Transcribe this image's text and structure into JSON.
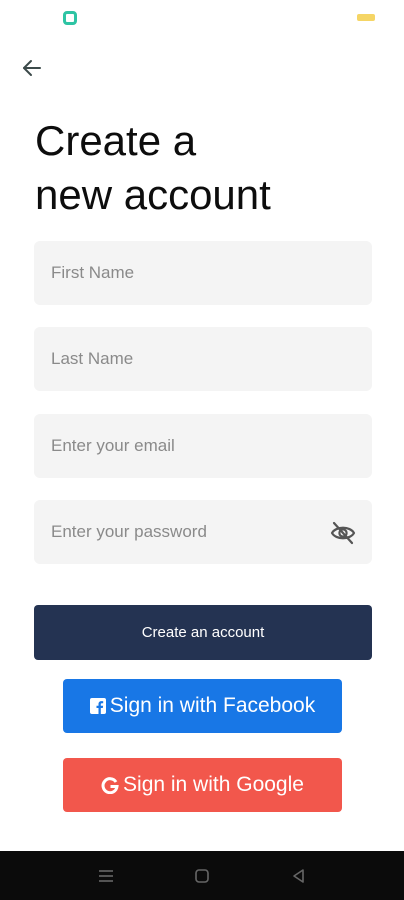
{
  "screen": {
    "title_line1": "Create a",
    "title_line2": "new account"
  },
  "form": {
    "first_name": {
      "placeholder": "First Name",
      "value": ""
    },
    "last_name": {
      "placeholder": "Last Name",
      "value": ""
    },
    "email": {
      "placeholder": "Enter your email",
      "value": ""
    },
    "password": {
      "placeholder": "Enter your password",
      "value": ""
    }
  },
  "buttons": {
    "create_account": "Create an account",
    "facebook": "Sign in with Facebook",
    "google": "Sign in with Google"
  },
  "icons": {
    "back": "arrow-left-icon",
    "password_toggle": "eye-off-icon",
    "facebook": "facebook-icon",
    "google": "google-icon",
    "nav_menu": "menu-icon",
    "nav_home": "square-home-icon",
    "nav_back": "triangle-back-icon"
  },
  "colors": {
    "primary": "#243352",
    "facebook": "#1877e6",
    "google": "#f2574c",
    "field_bg": "#f4f4f4"
  }
}
